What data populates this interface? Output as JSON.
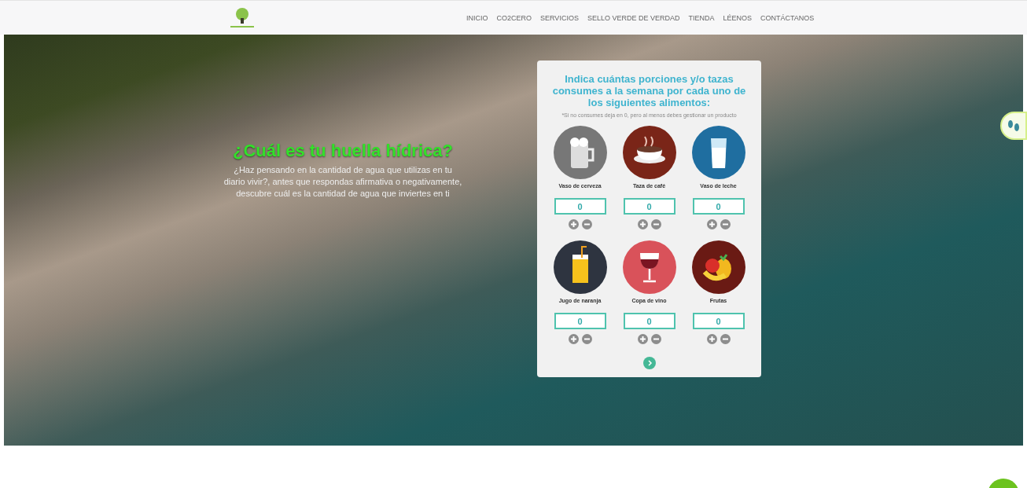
{
  "nav": {
    "items": [
      "INICIO",
      "CO2CERO",
      "SERVICIOS",
      "SELLO VERDE DE VERDAD",
      "TIENDA",
      "LÉENOS",
      "CONTÁCTANOS"
    ]
  },
  "hero": {
    "title": "¿Cuál es tu huella hídrica?",
    "text": "¿Haz pensando en la cantidad de agua que utilizas en tu diario vivir?, antes que respondas afirmativa o negativamente, descubre cuál es la cantidad de agua que inviertes en ti"
  },
  "card": {
    "title": "Indica cuántas porciones y/o tazas consumes a la semana por cada uno de los siguientes alimentos:",
    "note": "*Si no consumes deja en 0, pero al menos debes gestionar un producto",
    "items": [
      {
        "kind": "beer",
        "label": "Vaso de cerveza",
        "value": "0"
      },
      {
        "kind": "coffee",
        "label": "Taza de café",
        "value": "0"
      },
      {
        "kind": "milk",
        "label": "Vaso de leche",
        "value": "0"
      },
      {
        "kind": "juice",
        "label": "Jugo de naranja",
        "value": "0"
      },
      {
        "kind": "wine",
        "label": "Copa de vino",
        "value": "0"
      },
      {
        "kind": "fruit",
        "label": "Frutas",
        "value": "0"
      }
    ]
  }
}
